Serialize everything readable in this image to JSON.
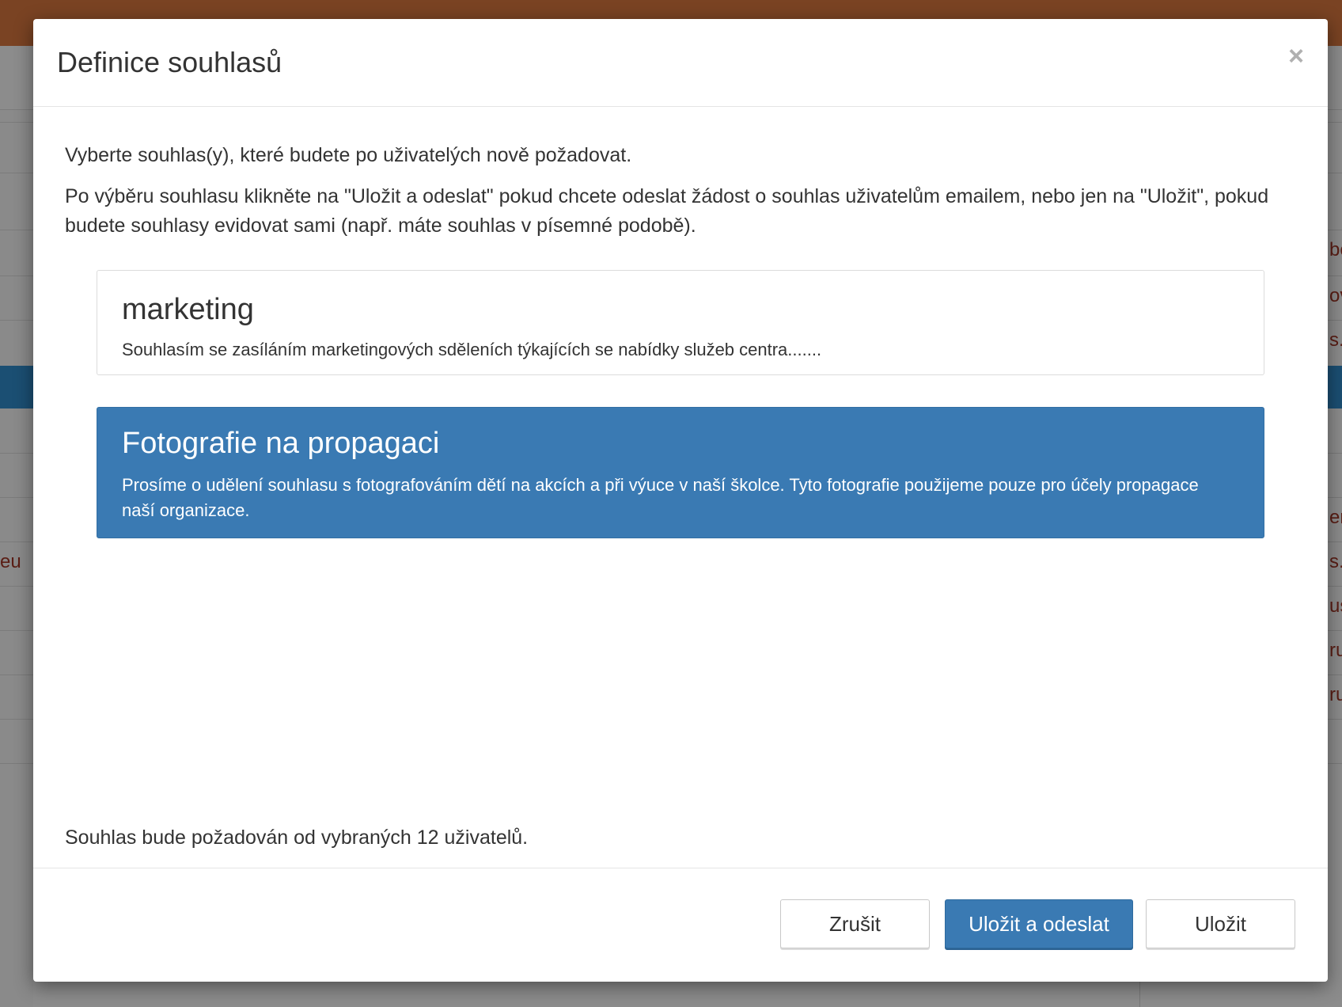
{
  "background": {
    "fragments_left": [
      "eu"
    ],
    "fragments_right": [
      "be",
      "ov",
      "s.e",
      "er",
      "s.e",
      "us",
      "ru",
      "ru"
    ]
  },
  "modal": {
    "title": "Definice souhlasů",
    "close_label": "×",
    "intro_line1": "Vyberte souhlas(y), které budete po uživatelých nově požadovat.",
    "intro_line2": "Po výběru souhlasu klikněte na \"Uložit a odeslat\" pokud chcete odeslat žádost o souhlas uživatelům emailem, nebo jen na \"Uložit\", pokud budete souhlasy evidovat sami (např. máte souhlas v písemné podobě).",
    "consents": [
      {
        "title": "marketing",
        "description": "Souhlasím se zasíláním marketingových sděleních týkajících se nabídky služeb centra.......",
        "selected": false
      },
      {
        "title": "Fotografie na propagaci",
        "description": "Prosíme o udělení souhlasu s fotografováním dětí na akcích a při výuce v naší školce. Tyto fotografie použijeme pouze pro účely propagace naší organizace.",
        "selected": true
      }
    ],
    "summary": "Souhlas bude požadován od vybraných 12 uživatelů.",
    "buttons": {
      "cancel": "Zrušit",
      "save_and_send": "Uložit a odeslat",
      "save": "Uložit"
    }
  },
  "colors": {
    "primary": "#3a7ab3",
    "topbar": "#7a4323"
  }
}
